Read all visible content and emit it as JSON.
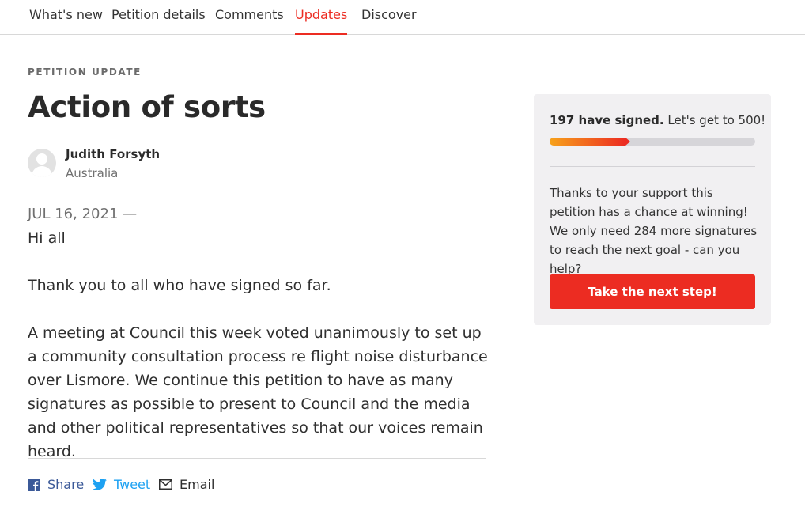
{
  "tabs": [
    {
      "label": "What's new",
      "active": false
    },
    {
      "label": "Petition details",
      "active": false
    },
    {
      "label": "Comments",
      "active": false
    },
    {
      "label": "Updates",
      "active": true
    },
    {
      "label": "Discover",
      "active": false
    }
  ],
  "article": {
    "kicker": "PETITION UPDATE",
    "title": "Action of sorts",
    "author": {
      "name": "Judith Forsyth",
      "location": "Australia",
      "avatar_icon": "default-avatar-icon"
    },
    "date": "JUL 16, 2021 —",
    "paragraphs": [
      "Hi all",
      "Thank you to all who have signed so far.",
      "A meeting at Council this week voted unanimously to set up a community consultation process re flight noise disturbance over Lismore. We continue this petition to have as many signatures as possible to present to Council and the media and other political representatives so that our voices remain heard."
    ]
  },
  "share": {
    "facebook": {
      "label": "Share",
      "icon": "facebook-icon",
      "color": "#3b5998"
    },
    "twitter": {
      "label": "Tweet",
      "icon": "twitter-icon",
      "color": "#1da1f2"
    },
    "email": {
      "label": "Email",
      "icon": "envelope-icon"
    }
  },
  "sidebar": {
    "signed_count": "197 have signed.",
    "goal_text": "Let's get to 500!",
    "signed": 197,
    "goal": 500,
    "progress_fraction": 0.394,
    "message": "Thanks to your support this petition has a chance at winning! We only need 284 more signatures to reach the next goal - can you help?",
    "cta_label": "Take the next step!"
  },
  "colors": {
    "accent": "#ec2c22",
    "progress_start": "#f7a21b",
    "sidebar_bg": "#f1f0f2"
  }
}
